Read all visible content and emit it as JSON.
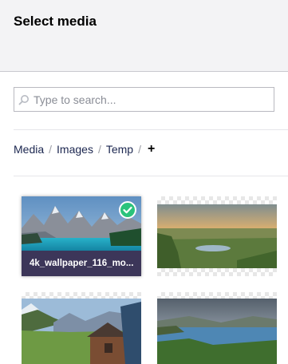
{
  "header": {
    "title": "Select media"
  },
  "search": {
    "placeholder": "Type to search..."
  },
  "breadcrumb": {
    "items": [
      "Media",
      "Images",
      "Temp"
    ],
    "add_icon": "plus-icon"
  },
  "media": [
    {
      "name": "4k_wallpaper_116_mo...",
      "selected": true
    },
    {
      "name": "",
      "selected": false
    },
    {
      "name": "",
      "selected": false
    },
    {
      "name": "",
      "selected": false
    }
  ],
  "colors": {
    "accent": "#2bc37c",
    "label_bg": "#3c3659",
    "text": "#1b264f"
  }
}
